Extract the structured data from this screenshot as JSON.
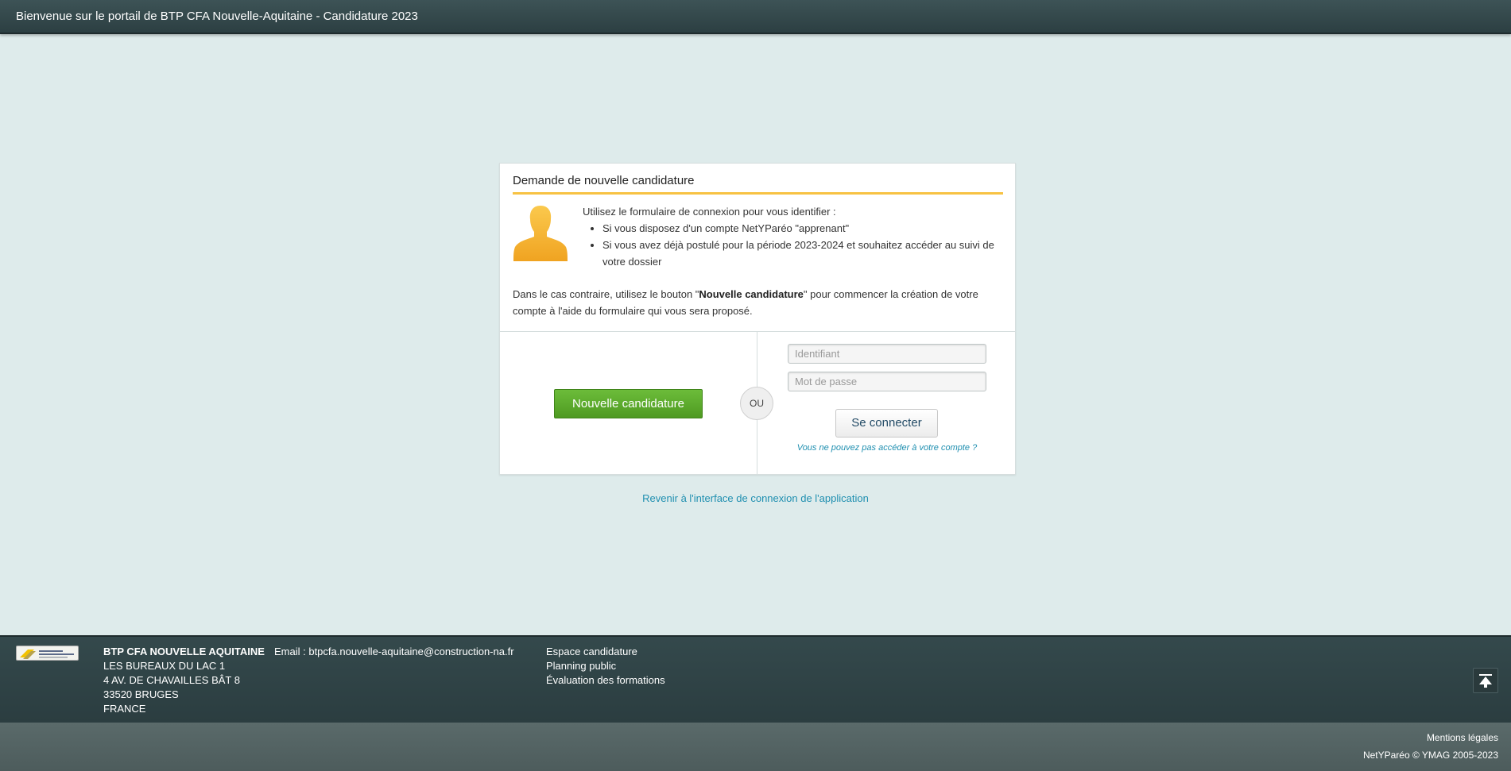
{
  "header": {
    "title": "Bienvenue sur le portail de BTP CFA Nouvelle-Aquitaine - Candidature 2023"
  },
  "card": {
    "title": "Demande de nouvelle candidature",
    "intro": "Utilisez le formulaire de connexion pour vous identifier :",
    "bullets": [
      "Si vous disposez d'un compte NetYParéo \"apprenant\"",
      "Si vous avez déjà postulé pour la période 2023-2024 et souhaitez accéder au suivi de votre dossier"
    ],
    "contrary_before": "Dans le cas contraire, utilisez le bouton \"",
    "contrary_bold": "Nouvelle candidature",
    "contrary_after": "\" pour commencer la création de votre compte à l'aide du formulaire qui vous sera proposé."
  },
  "actions": {
    "new_label": "Nouvelle candidature",
    "or_label": "OU",
    "login": {
      "username_placeholder": "Identifiant",
      "username_value": "",
      "password_placeholder": "Mot de passe",
      "password_value": "",
      "submit_label": "Se connecter",
      "forgot_label": "Vous ne pouvez pas accéder à votre compte ?"
    }
  },
  "back_link": "Revenir à l'interface de connexion de l'application",
  "footer": {
    "org_name": "BTP CFA NOUVELLE AQUITAINE",
    "address": [
      "LES BUREAUX DU LAC 1",
      "4 AV. DE CHAVAILLES BÂT 8",
      "33520 BRUGES",
      "FRANCE"
    ],
    "email": "Email : btpcfa.nouvelle-aquitaine@construction-na.fr",
    "links": [
      "Espace candidature",
      "Planning public",
      "Évaluation des formations"
    ],
    "logo_text": "BTP CFA NOUVELLE-AQUITAINE",
    "scroll_top_icon": "scroll-to-top-icon"
  },
  "bottom": {
    "legal": "Mentions légales",
    "copyright": "NetYParéo © YMAG 2005-2023"
  },
  "colors": {
    "background": "#deebeb",
    "header": "#2c3f42",
    "accent_orange": "#f7c243",
    "primary_green": "#5aa82c",
    "link_blue": "#1f8fb0"
  }
}
